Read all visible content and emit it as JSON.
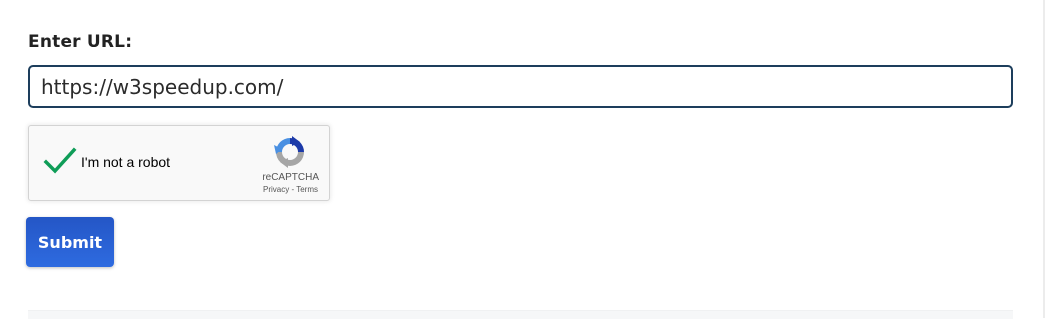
{
  "form": {
    "url_label": "Enter URL:",
    "url_value": "https://w3speedup.com/",
    "submit_label": "Submit"
  },
  "captcha": {
    "label": "I'm not a robot",
    "brand": "reCAPTCHA",
    "privacy_label": "Privacy",
    "separator": " - ",
    "terms_label": "Terms",
    "checked": true
  },
  "colors": {
    "input_border": "#1d3e5c",
    "button": "#2e6be0",
    "checkmark": "#0f9d58"
  }
}
